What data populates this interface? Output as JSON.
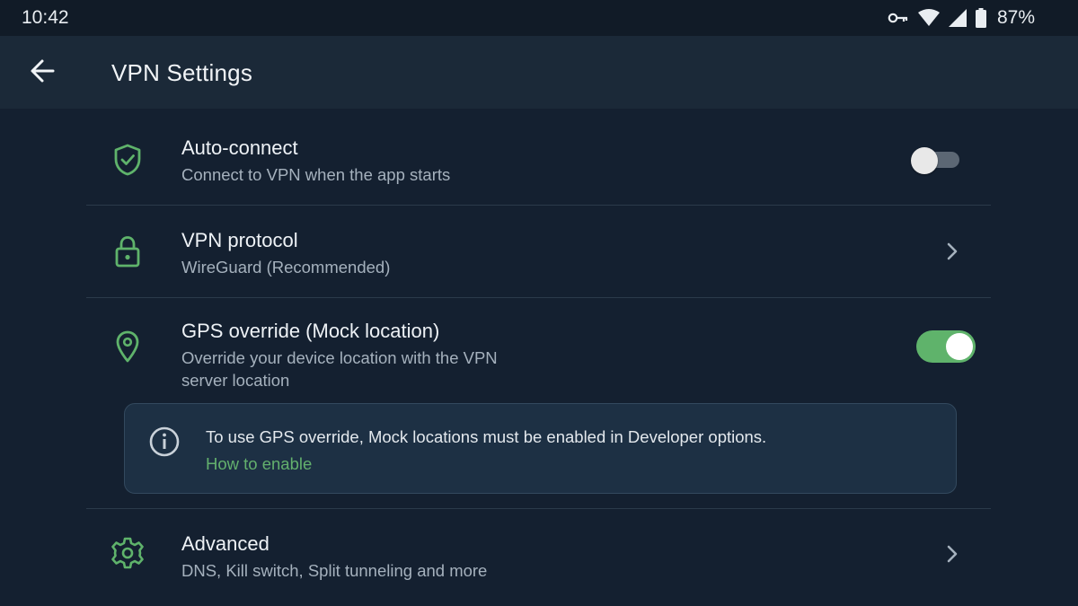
{
  "status_bar": {
    "time": "10:42",
    "battery_percent": "87%",
    "icons": [
      "vpn-key-icon",
      "wifi-icon",
      "cellular-signal-icon",
      "battery-icon"
    ]
  },
  "app_bar": {
    "title": "VPN Settings",
    "back_icon": "arrow-back-icon"
  },
  "colors": {
    "background": "#142030",
    "app_bar": "#1b2938",
    "accent_green": "#5fb36b",
    "link_green": "#63b06d",
    "info_card": "#1d3044"
  },
  "settings": {
    "auto_connect": {
      "icon": "shield-check-icon",
      "title": "Auto-connect",
      "subtitle": "Connect to VPN when the app starts",
      "enabled": false
    },
    "vpn_protocol": {
      "icon": "lock-icon",
      "title": "VPN protocol",
      "subtitle": "WireGuard (Recommended)"
    },
    "gps_override": {
      "icon": "location-pin-icon",
      "title": "GPS override (Mock location)",
      "subtitle_line1": "Override your device location with the VPN",
      "subtitle_line2": "server location",
      "enabled": true
    },
    "info_notice": {
      "icon": "info-icon",
      "text": "To use GPS override, Mock locations must be enabled in Developer options.",
      "link": "How to enable"
    },
    "advanced": {
      "icon": "gear-icon",
      "title": "Advanced",
      "subtitle": "DNS, Kill switch, Split tunneling and more"
    }
  }
}
